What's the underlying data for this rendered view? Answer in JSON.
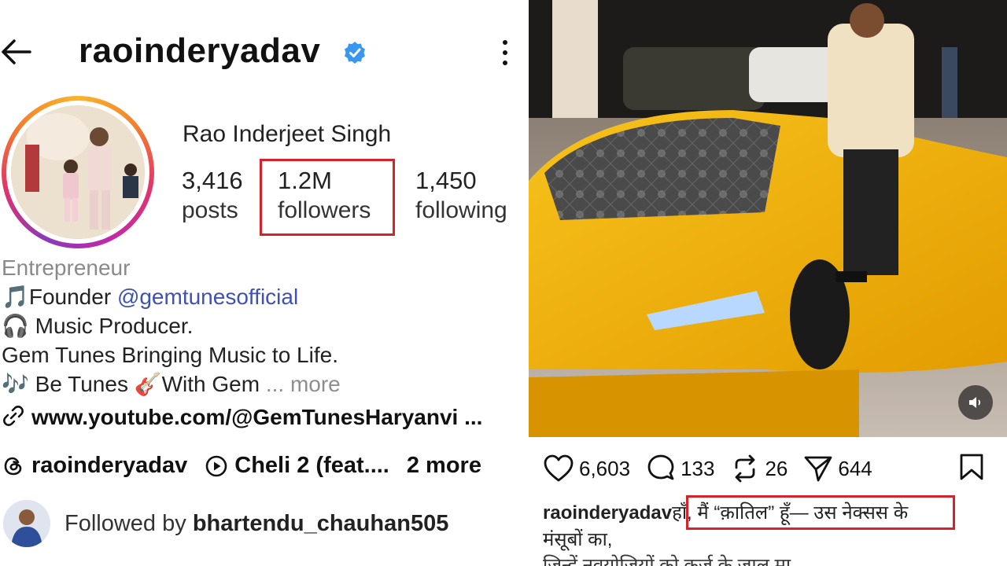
{
  "profile": {
    "username": "raoinderyadav",
    "verified": true,
    "full_name": "Rao Inderjeet Singh",
    "stats": {
      "posts_count": "3,416",
      "posts_label": "posts",
      "followers_count": "1.2M",
      "followers_label": "followers",
      "following_count": "1,450",
      "following_label": "following"
    },
    "bio": {
      "category": "Entrepreneur",
      "line1_prefix": "🎵Founder ",
      "line1_mention": "@gemtunesofficial",
      "line2": "🎧 Music Producer.",
      "line3": "Gem Tunes Bringing Music to Life.",
      "line4": "🎶 Be Tunes 🎸With Gem",
      "more": " ... more"
    },
    "link": "www.youtube.com/@GemTunesHaryanvi ...",
    "threads_handle": "raoinderyadav",
    "music_chip": "Cheli 2 (feat....",
    "more_chip": "2 more",
    "followed_by_prefix": "Followed by ",
    "followed_by_user": "bhartendu_chauhan505"
  },
  "post": {
    "likes": "6,603",
    "comments": "133",
    "reposts": "26",
    "shares": "644",
    "caption_user": "raoinderyadav",
    "caption_line1": "हाँ, मैं “क़ातिल” हूँ— उस नेक्सस के",
    "caption_line2": "मंसूबों का,",
    "caption_line3": "जिन्हें नवयोजियों को कर्ज़ के जाल मा"
  },
  "colors": {
    "highlight": "#d6232a",
    "verified_badge": "#3897f0",
    "mention": "#3f51b5",
    "car_yellow": "#f4b400"
  }
}
